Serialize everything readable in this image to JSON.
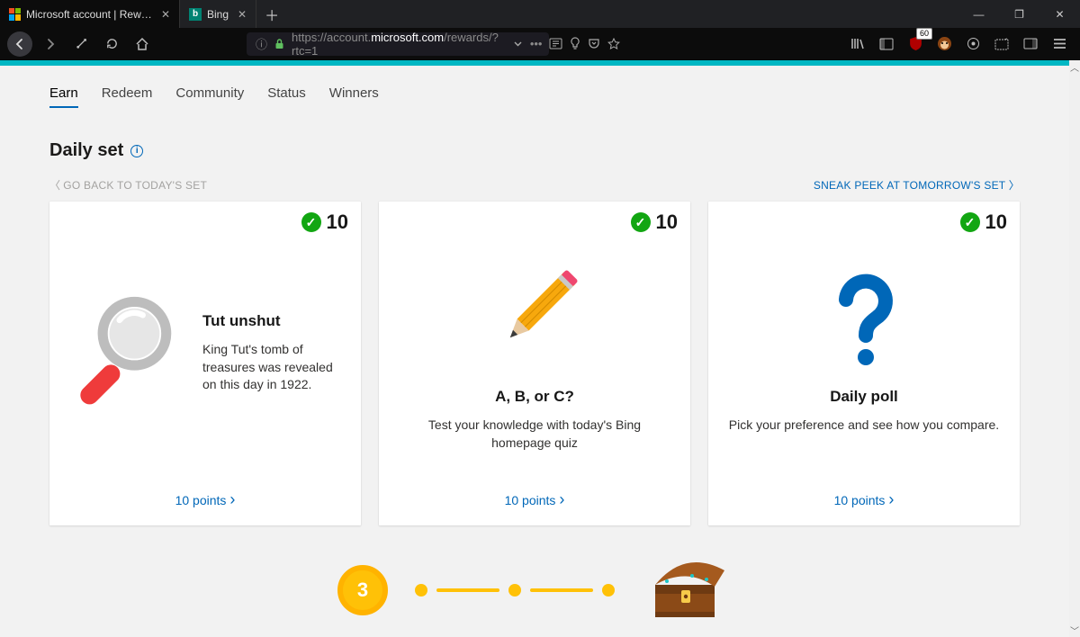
{
  "browser": {
    "tabs": [
      {
        "title": "Microsoft account | Rewards D…",
        "active": true
      },
      {
        "title": "Bing",
        "active": false
      }
    ],
    "url_info_icon": "ⓘ",
    "url_prefix": "https://",
    "url_host": "account.",
    "url_strong": "microsoft.com",
    "url_path": "/rewards/?rtc=1",
    "ext_badge": "60"
  },
  "nav": {
    "items": [
      "Earn",
      "Redeem",
      "Community",
      "Status",
      "Winners"
    ],
    "active": 0
  },
  "section": {
    "title": "Daily set",
    "back": "GO BACK TO TODAY'S SET",
    "peek": "SNEAK PEEK AT TOMORROW'S SET"
  },
  "cards": [
    {
      "points": "10",
      "title": "Tut unshut",
      "desc": "King Tut's tomb of treasures was revealed on this day in 1922.",
      "link": "10 points"
    },
    {
      "points": "10",
      "title": "A, B, or C?",
      "desc": "Test your knowledge with today's Bing homepage quiz",
      "link": "10 points"
    },
    {
      "points": "10",
      "title": "Daily poll",
      "desc": "Pick your preference and see how you compare.",
      "link": "10 points"
    }
  ],
  "streak": {
    "day": "3"
  }
}
